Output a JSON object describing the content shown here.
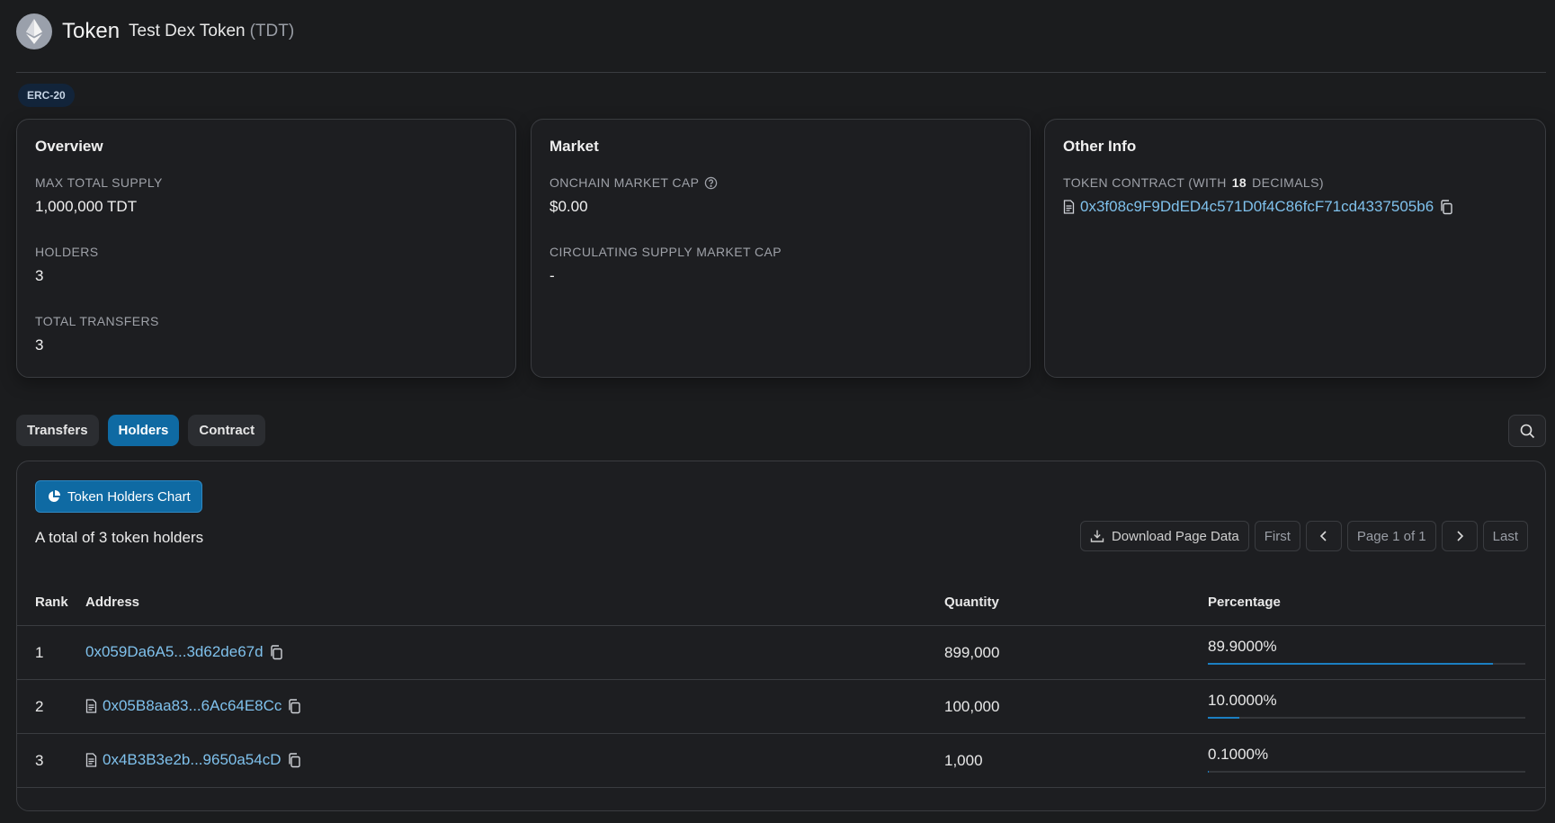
{
  "header": {
    "title": "Token",
    "token_name": "Test Dex Token",
    "token_symbol": "(TDT)"
  },
  "badge": "ERC-20",
  "overview": {
    "title": "Overview",
    "max_supply_label": "MAX TOTAL SUPPLY",
    "max_supply_value": "1,000,000 TDT",
    "holders_label": "HOLDERS",
    "holders_value": "3",
    "transfers_label": "TOTAL TRANSFERS",
    "transfers_value": "3"
  },
  "market": {
    "title": "Market",
    "onchain_cap_label": "ONCHAIN MARKET CAP",
    "onchain_cap_value": "$0.00",
    "circ_cap_label": "CIRCULATING SUPPLY MARKET CAP",
    "circ_cap_value": "-"
  },
  "other_info": {
    "title": "Other Info",
    "contract_label_prefix": "TOKEN CONTRACT (WITH",
    "contract_decimals": "18",
    "contract_label_suffix": "DECIMALS)",
    "contract_address": "0x3f08c9F9DdED4c571D0f4C86fcF71cd4337505b6"
  },
  "tabs": [
    {
      "label": "Transfers",
      "active": false
    },
    {
      "label": "Holders",
      "active": true
    },
    {
      "label": "Contract",
      "active": false
    }
  ],
  "holders_panel": {
    "chart_button": "Token Holders Chart",
    "total_text": "A total of 3 token holders",
    "download_label": "Download Page Data",
    "first_label": "First",
    "page_label": "Page 1 of 1",
    "last_label": "Last",
    "columns": {
      "rank": "Rank",
      "address": "Address",
      "quantity": "Quantity",
      "percentage": "Percentage"
    },
    "rows": [
      {
        "rank": "1",
        "address": "0x059Da6A5...3d62de67d",
        "is_contract": false,
        "quantity": "899,000",
        "percentage": "89.9000%",
        "pct_value": 89.9
      },
      {
        "rank": "2",
        "address": "0x05B8aa83...6Ac64E8Cc",
        "is_contract": true,
        "quantity": "100,000",
        "percentage": "10.0000%",
        "pct_value": 10.0
      },
      {
        "rank": "3",
        "address": "0x4B3B3e2b...9650a54cD",
        "is_contract": true,
        "quantity": "1,000",
        "percentage": "0.1000%",
        "pct_value": 0.1
      }
    ]
  },
  "colors": {
    "accent": "#0f6aa3",
    "link": "#7fc1ec",
    "background": "#1b1c1e",
    "bar_fill": "#1b7fc2"
  },
  "icons": [
    "ethereum-logo-icon",
    "help-circle-icon",
    "document-icon",
    "copy-icon",
    "search-icon",
    "pie-chart-icon",
    "download-icon",
    "chevron-left-icon",
    "chevron-right-icon"
  ]
}
